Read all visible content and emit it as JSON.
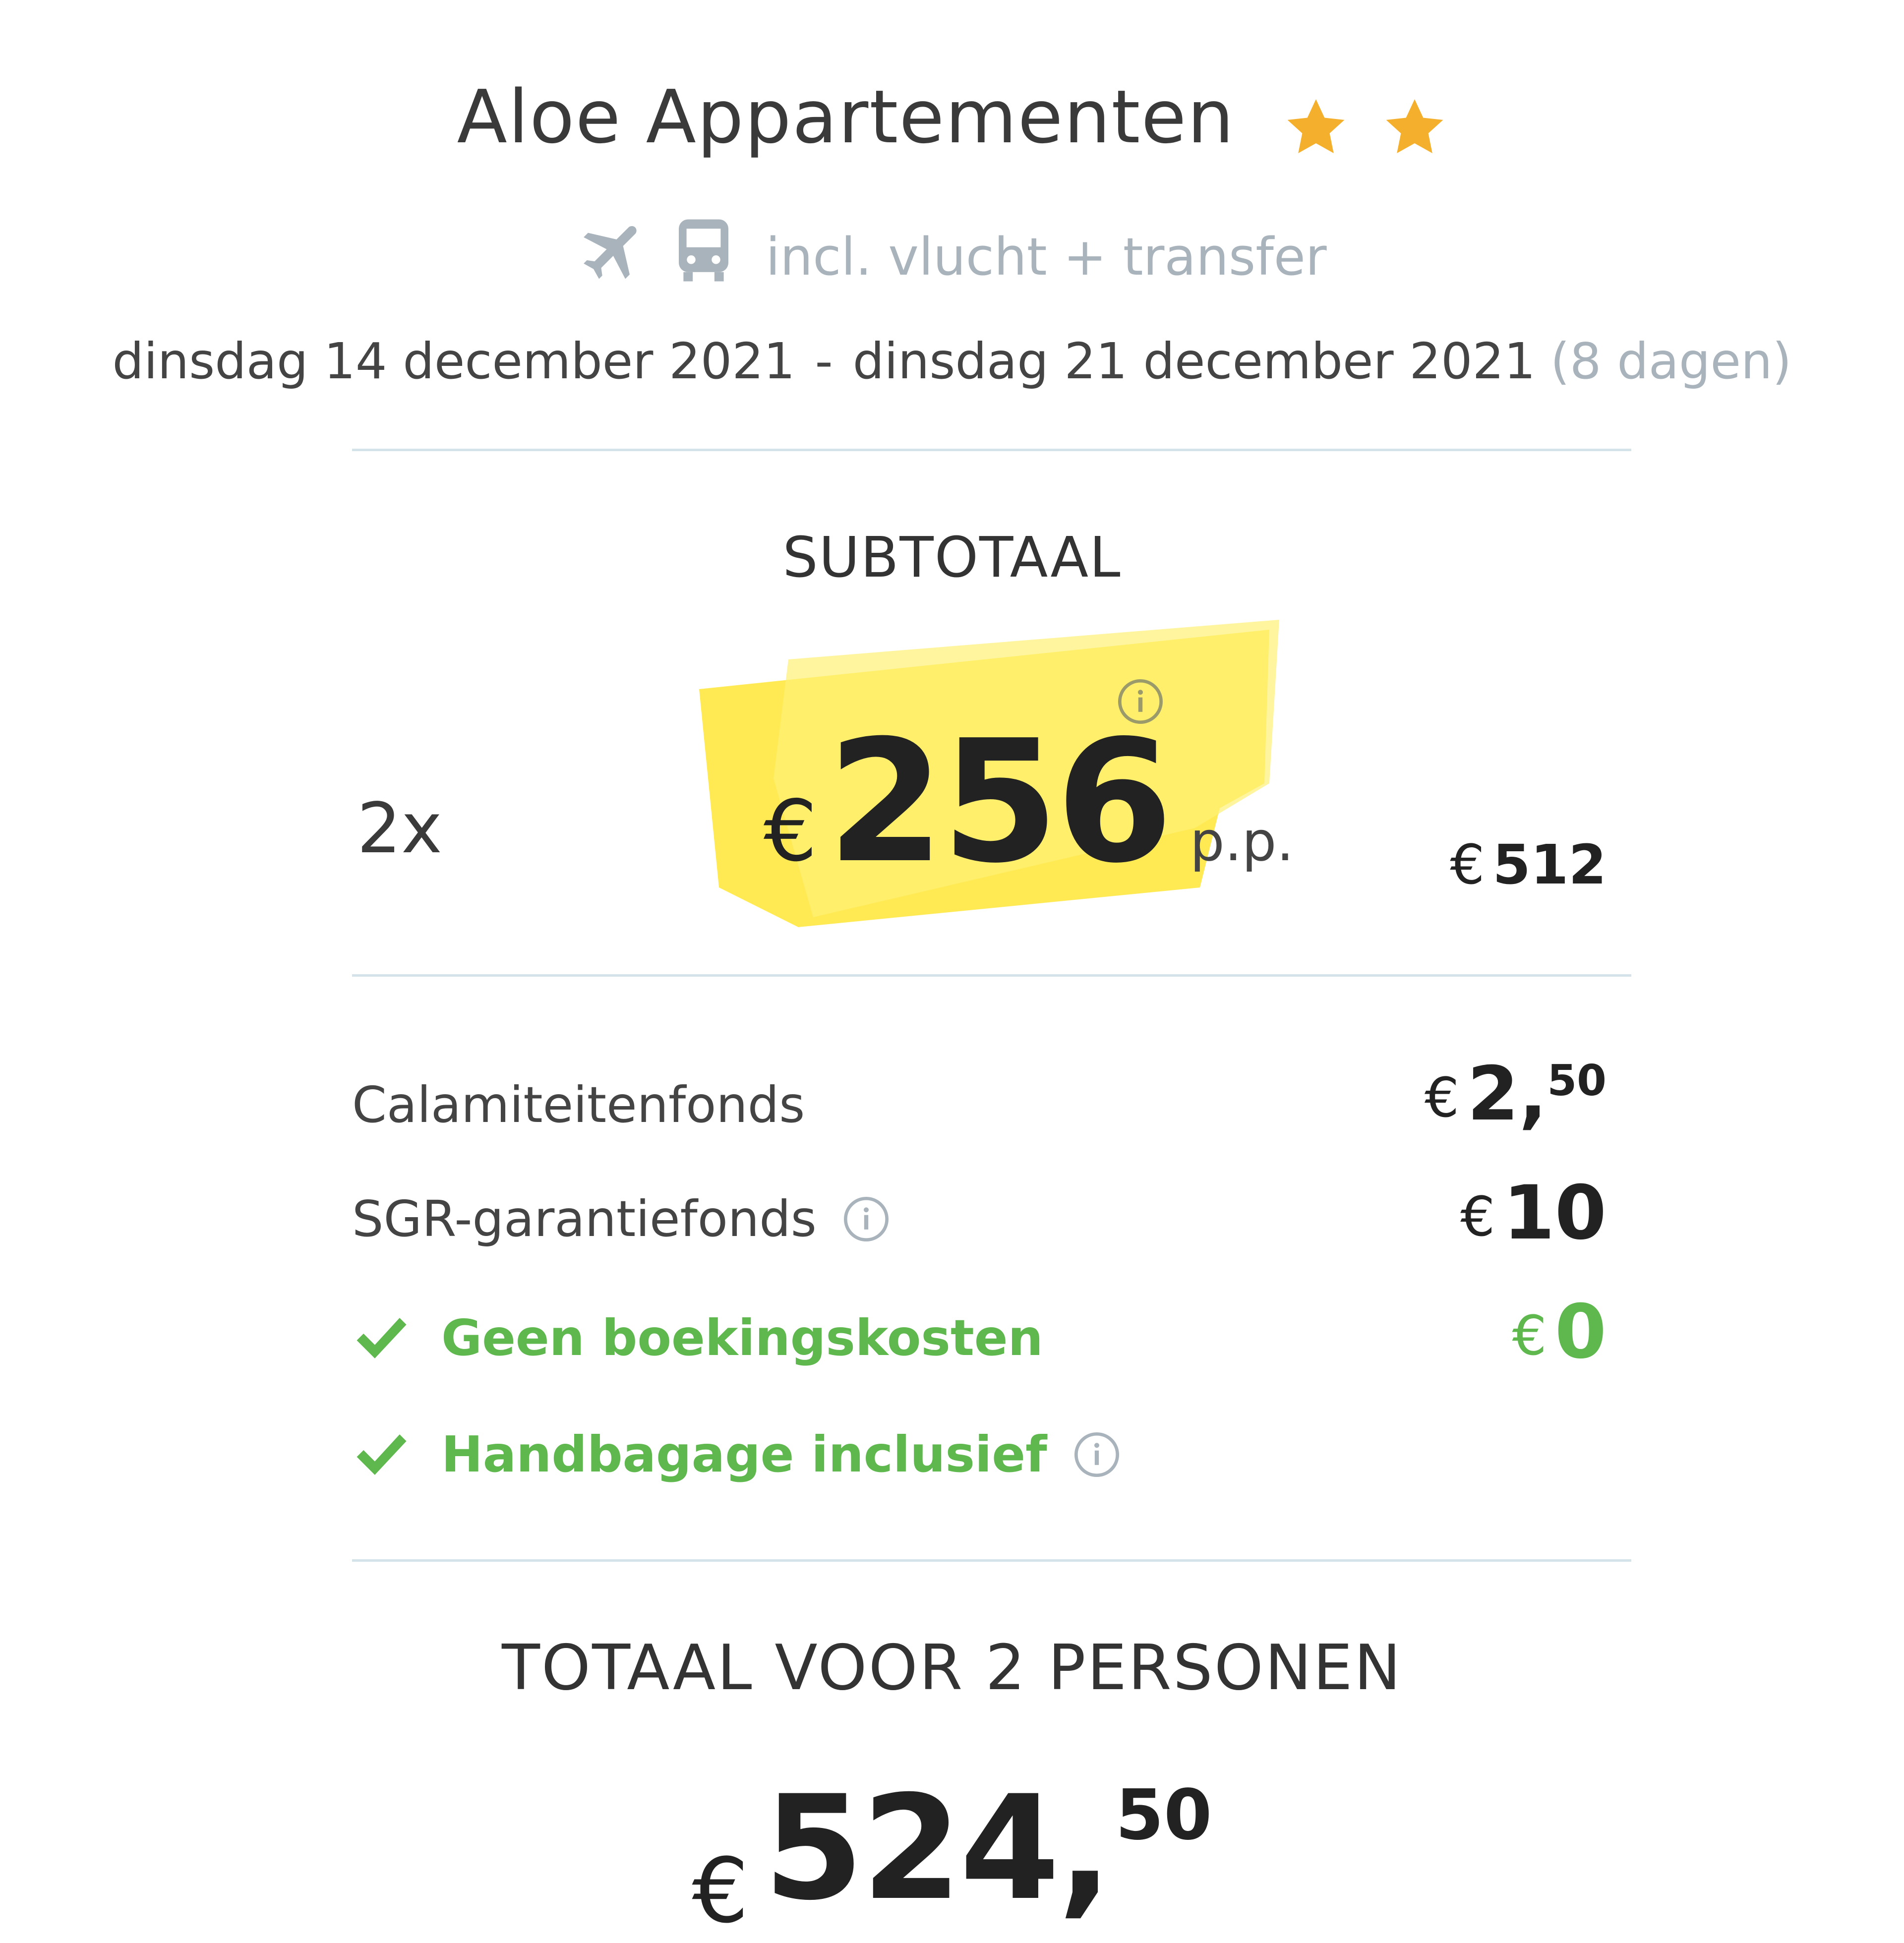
{
  "hotel": {
    "name": "Aloe Appartementen",
    "star_count": 2,
    "star_color": "#f4b02c"
  },
  "package": {
    "icons": [
      "airplane-icon",
      "bus-icon"
    ],
    "text": "incl. vlucht + transfer"
  },
  "dates": {
    "start": "dinsdag 14 december 2021",
    "separator": "-",
    "end": "dinsdag 21 december 2021",
    "duration": "(8 dagen)"
  },
  "subtotal": {
    "label": "SUBTOTAAL",
    "quantity": "2x",
    "currency": "€",
    "price_pp": "256",
    "pp_suffix": "p.p.",
    "total_currency": "€",
    "total": "512",
    "highlight_color": "#ffe94a"
  },
  "fees": [
    {
      "label": "Calamiteitenfonds",
      "currency": "€",
      "whole": "2,",
      "cents": "50",
      "info": false
    },
    {
      "label": "SGR-garantiefonds",
      "currency": "€",
      "whole": "10",
      "cents": "",
      "info": true
    },
    {
      "label": "Geen boekingskosten",
      "currency": "€",
      "whole": "0",
      "cents": "",
      "info": false,
      "check": true
    },
    {
      "label": "Handbagage inclusief",
      "info": true,
      "check": true
    }
  ],
  "total": {
    "label": "TOTAAL VOOR 2 PERSONEN",
    "currency": "€",
    "whole": "524,",
    "cents": "50"
  },
  "colors": {
    "green": "#5fb84e",
    "muted": "#a9b3bc",
    "divider": "#d4e2ea"
  }
}
